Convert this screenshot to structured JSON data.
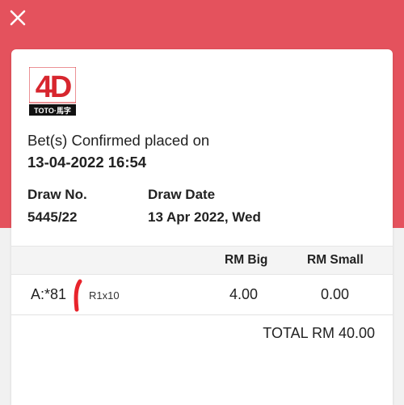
{
  "header": {
    "close_icon": "close-icon",
    "band_color": "#e4525d"
  },
  "logo": {
    "text": "4D",
    "caption": "TOTO · 馬字",
    "accent": "#d7262e"
  },
  "confirmation": {
    "label": "Bet(s) Confirmed placed on",
    "datetime": "13-04-2022 16:54"
  },
  "draw": {
    "number_label": "Draw No.",
    "number": "5445/22",
    "date_label": "Draw Date",
    "date": "13 Apr 2022, Wed"
  },
  "table": {
    "col_big": "RM Big",
    "col_small": "RM Small",
    "rows": [
      {
        "number": "A:*81",
        "bet_type": "R1x10",
        "big": "4.00",
        "small": "0.00"
      }
    ]
  },
  "total": "TOTAL RM 40.00"
}
